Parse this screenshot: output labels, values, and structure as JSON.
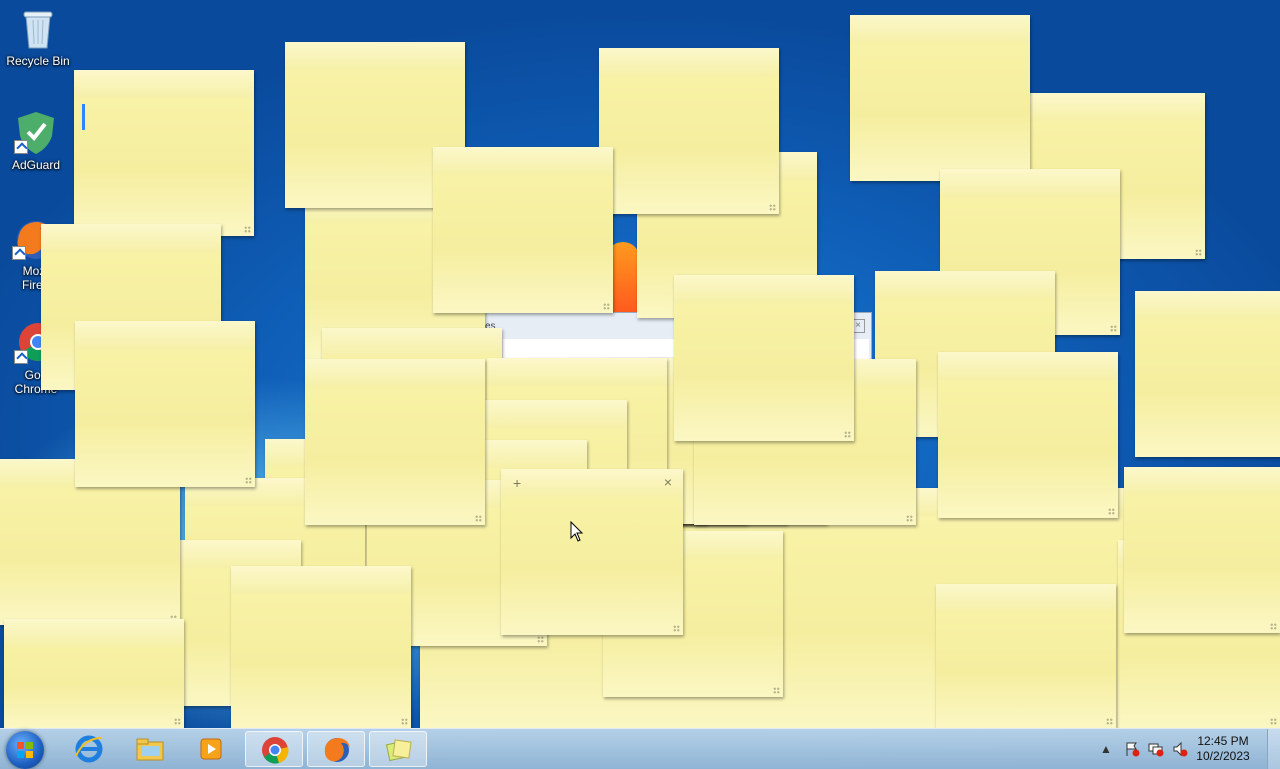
{
  "desktop": {
    "icons": [
      {
        "label": "Recycle Bin"
      },
      {
        "label": "AdGuard"
      },
      {
        "label": "Mozilla Firefox",
        "label_line1": "Moz",
        "label_line2": "Firef"
      },
      {
        "label": "Google Chrome",
        "label_line1": "Goo",
        "label_line2": "Chrome"
      }
    ]
  },
  "background_window": {
    "partial_label": "es"
  },
  "sticky_note_active": {
    "new_note_label": "+",
    "close_label": "×"
  },
  "taskbar": {
    "pinned": [
      {
        "name": "Internet Explorer"
      },
      {
        "name": "Windows Explorer"
      },
      {
        "name": "Windows Media Player"
      },
      {
        "name": "Google Chrome"
      },
      {
        "name": "Mozilla Firefox"
      },
      {
        "name": "Sticky Notes"
      }
    ],
    "clock": {
      "time": "12:45 PM",
      "date": "10/2/2023"
    }
  },
  "colors": {
    "note_bg": "#f8f2a6",
    "desktop_blue": "#0f5fb8",
    "caret": "#2f86ff"
  }
}
